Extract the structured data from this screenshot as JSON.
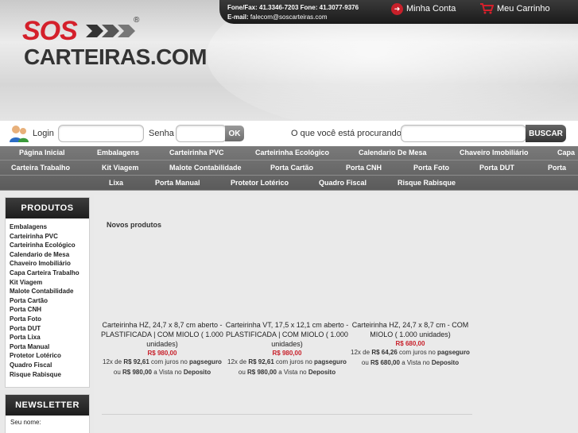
{
  "header": {
    "phone_label": "Fone/Fax:",
    "phone_value": "41.3346-7203",
    "phone2_label": "Fone:",
    "phone2_value": "41.3077-9376",
    "email_label": "E-mail:",
    "email_value": "falecom@soscarteiras.com",
    "account_link": "Minha Conta",
    "cart_link": "Meu Carrinho",
    "logo_top": "SOS",
    "logo_bottom": "CARTEIRAS.COM",
    "logo_reg": "®"
  },
  "login": {
    "login_label": "Login",
    "password_label": "Senha",
    "ok_label": "OK",
    "search_question": "O que você está procurando?",
    "search_button": "BUSCAR"
  },
  "nav": {
    "row1": [
      "Página Inicial",
      "Embalagens",
      "Carteirinha PVC",
      "Carteirinha Ecológico",
      "Calendario De Mesa",
      "Chaveiro Imobiliário",
      "Capa"
    ],
    "row2": [
      "Carteira Trabalho",
      "Kit Viagem",
      "Malote Contabilidade",
      "Porta Cartão",
      "Porta CNH",
      "Porta Foto",
      "Porta DUT",
      "Porta"
    ],
    "row3": [
      "Lixa",
      "Porta Manual",
      "Protetor Lotérico",
      "Quadro Fiscal",
      "Risque Rabisque"
    ]
  },
  "sidebar": {
    "products_title": "PRODUTOS",
    "categories": [
      "Embalagens",
      "Carteirinha PVC",
      "Carteirinha Ecológico",
      "Calendario de Mesa",
      "Chaveiro Imobiliário",
      "Capa Carteira Trabalho",
      "Kit Viagem",
      "Malote Contabilidade",
      "Porta Cartão",
      "Porta CNH",
      "Porta Foto",
      "Porta DUT",
      "Porta Lixa",
      "Porta Manual",
      "Protetor Lotérico",
      "Quadro Fiscal",
      "Risque Rabisque"
    ],
    "newsletter_title": "NEWSLETTER",
    "newsletter_name_label": "Seu nome:"
  },
  "main": {
    "section_title": "Novos produtos",
    "products": [
      {
        "name": "Carteirinha HZ, 24,7 x 8,7 cm aberto - PLASTIFICADA | COM MIOLO ( 1.000 unidades)",
        "price": "R$ 980,00",
        "inst_count": "12x",
        "inst_de": "de",
        "inst_value": "R$ 92,61",
        "inst_mid": "com juros no",
        "inst_gateway": "pagseguro",
        "alt_ou": "ou",
        "alt_value": "R$ 980,00",
        "alt_mid": "a Vista no",
        "alt_method": "Deposito"
      },
      {
        "name": "Carteirinha VT, 17,5 x 12,1 cm aberto - PLASTIFICADA | COM MIOLO ( 1.000 unidades)",
        "price": "R$ 980,00",
        "inst_count": "12x",
        "inst_de": "de",
        "inst_value": "R$ 92,61",
        "inst_mid": "com juros no",
        "inst_gateway": "pagseguro",
        "alt_ou": "ou",
        "alt_value": "R$ 980,00",
        "alt_mid": "a Vista no",
        "alt_method": "Deposito"
      },
      {
        "name": "Carteirinha HZ, 24,7 x 8,7 cm - COM MIOLO ( 1.000 unidades)",
        "price": "R$ 680,00",
        "inst_count": "12x",
        "inst_de": "de",
        "inst_value": "R$ 64,26",
        "inst_mid": "com juros no",
        "inst_gateway": "pagseguro",
        "alt_ou": "ou",
        "alt_value": "R$ 680,00",
        "alt_mid": "a Vista no",
        "alt_method": "Deposito"
      }
    ]
  },
  "colors": {
    "brand_red": "#d4202b",
    "price_red": "#c8202a",
    "nav_bg": "#6a6a6a",
    "topbar_bg": "#1f1f1f"
  }
}
